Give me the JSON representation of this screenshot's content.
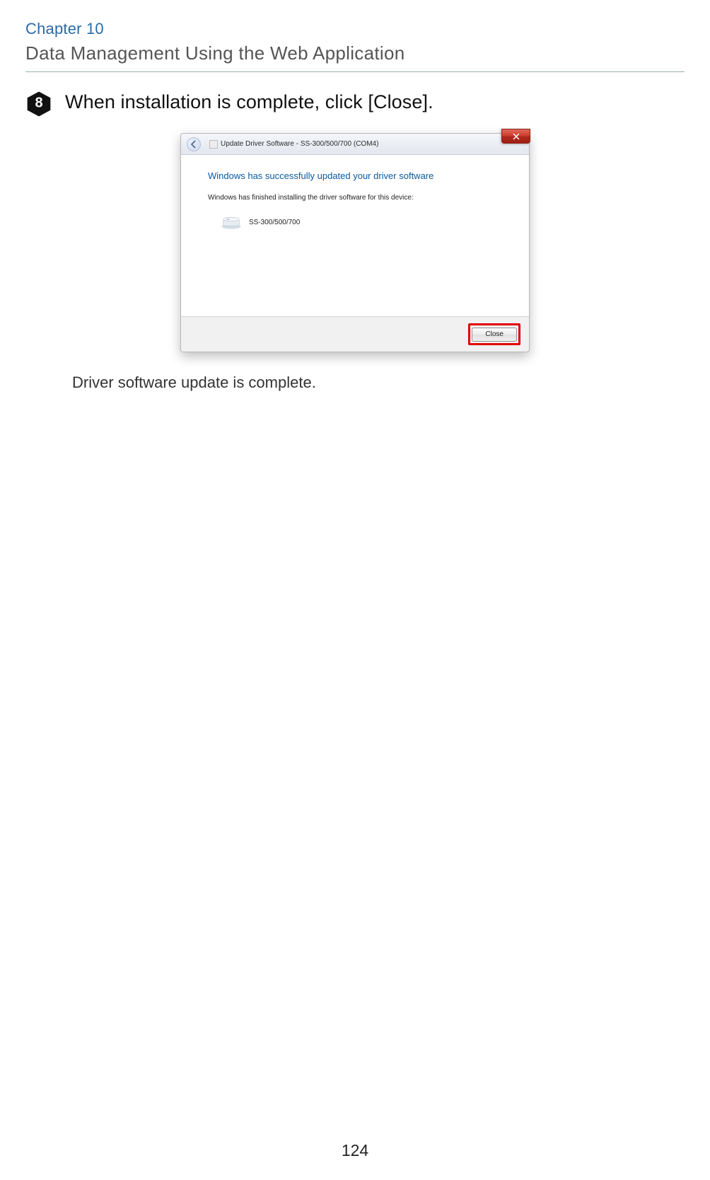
{
  "chapter": {
    "label": "Chapter 10",
    "title": "Data Management Using the Web Application"
  },
  "step": {
    "number": "8",
    "text": "When installation is complete, click [Close]."
  },
  "dialog": {
    "title": "Update Driver Software - SS-300/500/700 (COM4)",
    "headline": "Windows has successfully updated your driver software",
    "subtext": "Windows has finished installing the driver software for this device:",
    "device_name": "SS-300/500/700",
    "close_button": "Close"
  },
  "result_text": "Driver software update is complete.",
  "page_number": "124"
}
